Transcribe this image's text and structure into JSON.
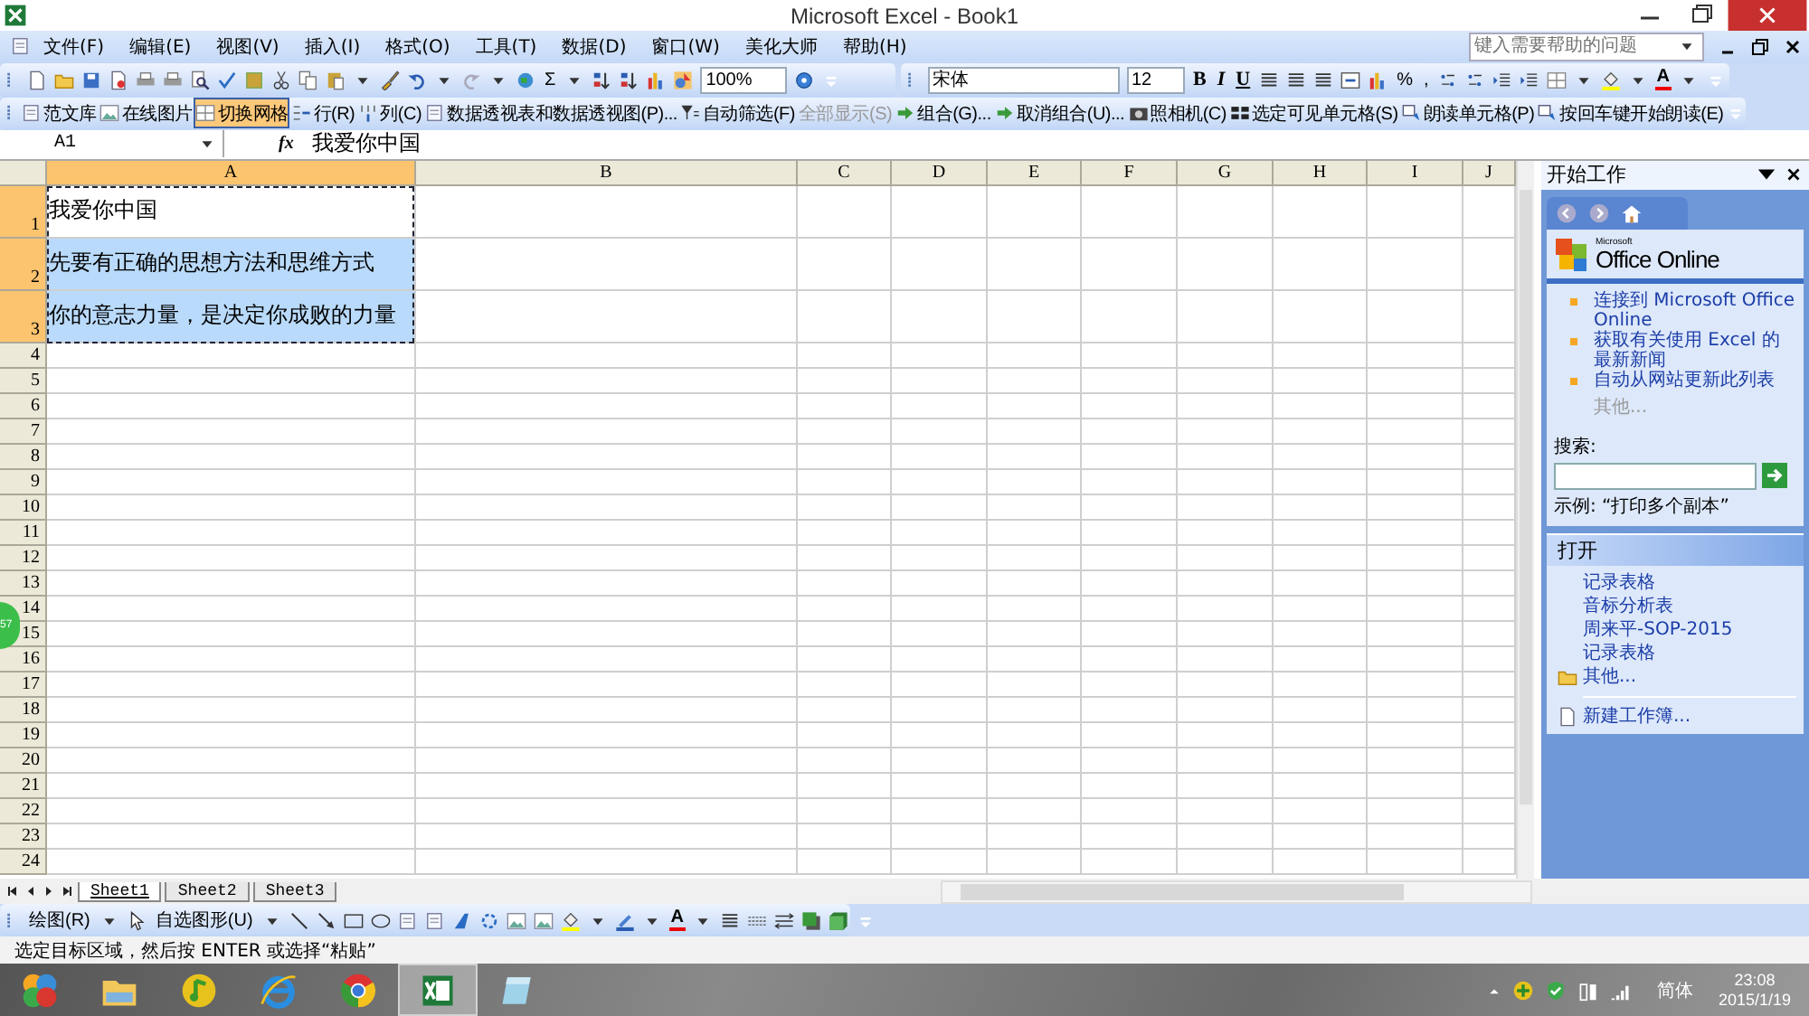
{
  "window": {
    "title": "Microsoft Excel - Book1"
  },
  "menu": {
    "items": [
      "文件(F)",
      "编辑(E)",
      "视图(V)",
      "插入(I)",
      "格式(O)",
      "工具(T)",
      "数据(D)",
      "窗口(W)",
      "美化大师",
      "帮助(H)"
    ],
    "help_search": {
      "placeholder": "键入需要帮助的问题"
    }
  },
  "standard_toolbar": {
    "sum": "Σ",
    "zoom": "100%"
  },
  "formatting_toolbar": {
    "font": "宋体",
    "size": "12",
    "styles": [
      "B",
      "I",
      "U"
    ],
    "symbols": [
      "%",
      ","
    ],
    "font_color": "A"
  },
  "custom_toolbar": {
    "items": [
      {
        "label": "范文库",
        "selected": false,
        "disabled": false
      },
      {
        "label": "在线图片",
        "selected": false,
        "disabled": false
      },
      {
        "label": "切换网格",
        "selected": true,
        "disabled": false
      },
      {
        "label": "行(R)",
        "selected": false,
        "disabled": false
      },
      {
        "label": "列(C)",
        "selected": false,
        "disabled": false
      },
      {
        "label": "数据透视表和数据透视图(P)...",
        "selected": false,
        "disabled": false
      },
      {
        "label": "自动筛选(F)",
        "selected": false,
        "disabled": false
      },
      {
        "label": "全部显示(S)",
        "selected": false,
        "disabled": true
      },
      {
        "label": "组合(G)...",
        "selected": false,
        "disabled": false
      },
      {
        "label": "取消组合(U)...",
        "selected": false,
        "disabled": false
      },
      {
        "label": "照相机(C)",
        "selected": false,
        "disabled": false
      },
      {
        "label": "选定可见单元格(S)",
        "selected": false,
        "disabled": false
      },
      {
        "label": "朗读单元格(P)",
        "selected": false,
        "disabled": false
      },
      {
        "label": "按回车键开始朗读(E)",
        "selected": false,
        "disabled": false
      }
    ]
  },
  "formula_bar": {
    "name_box": "A1",
    "fx": "fx",
    "content": "我爱你中国"
  },
  "sheet": {
    "columns": [
      {
        "label": "A",
        "selected": true
      },
      {
        "label": "B",
        "selected": false
      },
      {
        "label": "C",
        "selected": false
      },
      {
        "label": "D",
        "selected": false
      },
      {
        "label": "E",
        "selected": false
      },
      {
        "label": "F",
        "selected": false
      },
      {
        "label": "G",
        "selected": false
      },
      {
        "label": "H",
        "selected": false
      },
      {
        "label": "I",
        "selected": false
      },
      {
        "label": "J",
        "selected": false
      }
    ],
    "rows": [
      {
        "label": "1",
        "selected": true,
        "cell_a": {
          "text": "我爱你中国",
          "selected": false
        }
      },
      {
        "label": "2",
        "selected": true,
        "cell_a": {
          "text": "先要有正确的思想方法和思维方式",
          "selected": true
        }
      },
      {
        "label": "3",
        "selected": true,
        "cell_a": {
          "text": "你的意志力量，是决定你成败的力量",
          "selected": true
        }
      },
      {
        "label": "4",
        "selected": false
      },
      {
        "label": "5",
        "selected": false
      },
      {
        "label": "6",
        "selected": false
      },
      {
        "label": "7",
        "selected": false
      },
      {
        "label": "8",
        "selected": false
      },
      {
        "label": "9",
        "selected": false
      },
      {
        "label": "10",
        "selected": false
      },
      {
        "label": "11",
        "selected": false
      },
      {
        "label": "12",
        "selected": false
      },
      {
        "label": "13",
        "selected": false
      },
      {
        "label": "14",
        "selected": false
      },
      {
        "label": "15",
        "selected": false
      },
      {
        "label": "16",
        "selected": false
      },
      {
        "label": "17",
        "selected": false
      },
      {
        "label": "18",
        "selected": false
      },
      {
        "label": "19",
        "selected": false
      },
      {
        "label": "20",
        "selected": false
      },
      {
        "label": "21",
        "selected": false
      },
      {
        "label": "22",
        "selected": false
      },
      {
        "label": "23",
        "selected": false
      },
      {
        "label": "24",
        "selected": false
      }
    ],
    "badge": "57",
    "tabs": [
      {
        "label": "Sheet1",
        "selected": true
      },
      {
        "label": "Sheet2",
        "selected": false
      },
      {
        "label": "Sheet3",
        "selected": false
      }
    ]
  },
  "task_pane": {
    "title": "开始工作",
    "logo_small": "Microsoft",
    "logo": "Office Online",
    "links": [
      "连接到 Microsoft Office Online",
      "获取有关使用 Excel 的最新新闻",
      "自动从网站更新此列表"
    ],
    "more": "其他...",
    "search_label": "搜索:",
    "example": "示例: “打印多个副本”",
    "open_section": {
      "title": "打开",
      "files": [
        "记录表格",
        "音标分析表",
        "周来平-SOP-2015",
        "记录表格"
      ],
      "more": "其他...",
      "new_workbook": "新建工作簿..."
    }
  },
  "drawing_toolbar": {
    "draw": "绘图(R)",
    "autoshapes": "自选图形(U)",
    "font_color": "A"
  },
  "status_bar": "选定目标区域，然后按 ENTER 或选择“粘贴”",
  "taskbar": {
    "apps": [
      {
        "selected": false
      },
      {
        "selected": false
      },
      {
        "selected": false
      },
      {
        "selected": false
      },
      {
        "selected": false
      },
      {
        "selected": true
      },
      {
        "selected": false
      }
    ],
    "language": "简体",
    "time": "23:08",
    "date": "2015/1/19"
  }
}
